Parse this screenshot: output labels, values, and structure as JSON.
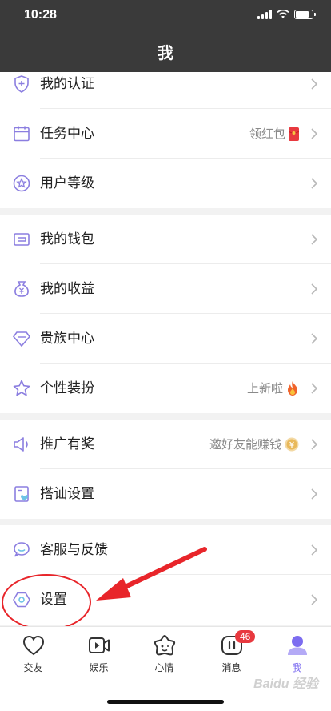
{
  "status_bar": {
    "time": "10:28"
  },
  "nav": {
    "title": "我"
  },
  "groups": [
    [
      {
        "id": "cert",
        "label": "我的认证",
        "icon": "shield-plus-icon",
        "right_text": ""
      },
      {
        "id": "task",
        "label": "任务中心",
        "icon": "calendar-icon",
        "right_text": "领红包"
      },
      {
        "id": "level",
        "label": "用户等级",
        "icon": "star-badge-icon",
        "right_text": ""
      }
    ],
    [
      {
        "id": "wallet",
        "label": "我的钱包",
        "icon": "wallet-icon",
        "right_text": ""
      },
      {
        "id": "income",
        "label": "我的收益",
        "icon": "money-bag-icon",
        "right_text": ""
      },
      {
        "id": "noble",
        "label": "贵族中心",
        "icon": "diamond-icon",
        "right_text": ""
      },
      {
        "id": "dress",
        "label": "个性装扮",
        "icon": "star-icon",
        "right_text": "上新啦"
      }
    ],
    [
      {
        "id": "promo",
        "label": "推广有奖",
        "icon": "speaker-icon",
        "right_text": "邀好友能赚钱"
      },
      {
        "id": "chat",
        "label": "搭讪设置",
        "icon": "heart-doc-icon",
        "right_text": ""
      }
    ],
    [
      {
        "id": "service",
        "label": "客服与反馈",
        "icon": "chat-bubble-icon",
        "right_text": ""
      },
      {
        "id": "settings",
        "label": "设置",
        "icon": "hexagon-gear-icon",
        "right_text": ""
      }
    ]
  ],
  "tabs": [
    {
      "label": "交友",
      "icon": "heart-outline-icon"
    },
    {
      "label": "娱乐",
      "icon": "video-play-icon"
    },
    {
      "label": "心情",
      "icon": "star-face-icon"
    },
    {
      "label": "消息",
      "icon": "message-pause-icon",
      "badge": "46"
    },
    {
      "label": "我",
      "icon": "user-avatar-icon",
      "active": true
    }
  ],
  "watermark": "Baidu 经验",
  "colors": {
    "header": "#3a3a3a",
    "icon_accent": "#8b7ee0",
    "active_tab": "#7c6cf0",
    "badge": "#e8393f",
    "annotation": "#e8252a"
  }
}
